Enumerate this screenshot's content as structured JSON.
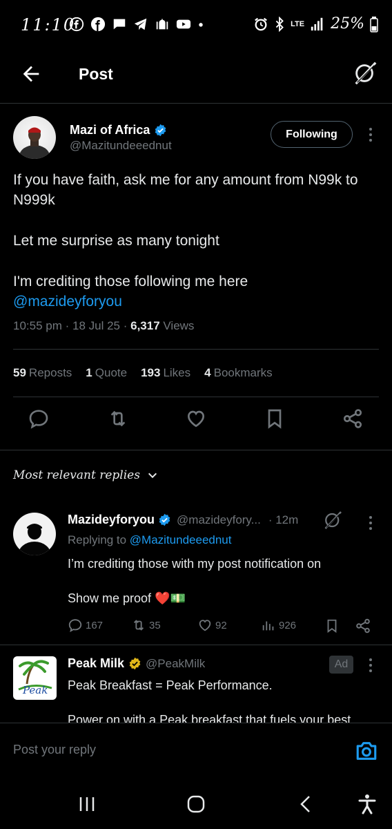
{
  "status_bar": {
    "time": "11:10",
    "network": "LTE",
    "battery": "25%",
    "icons": [
      "facebook-icon",
      "facebook-icon",
      "chat-icon",
      "telegram-icon",
      "mosque-icon",
      "youtube-icon",
      "dot-icon",
      "alarm-icon",
      "bluetooth-icon",
      "signal-icon",
      "battery-icon"
    ]
  },
  "header": {
    "title": "Post",
    "back_icon": "arrow-left-icon",
    "grok_icon": "grok-icon"
  },
  "post": {
    "author_name": "Mazi of Africa",
    "author_handle": "@Mazitundeeednut",
    "follow_label": "Following",
    "text_line1": "If you have faith, ask me for any amount from N99k to N999k",
    "text_line2": "Let me surprise as many tonight",
    "text_line3": "I'm crediting those following me here",
    "mention": "@mazideyforyou",
    "time": "10:55 pm",
    "date": "18 Jul 25",
    "views_count": "6,317",
    "views_label": "Views",
    "reposts_count": "59",
    "reposts_label": "Reposts",
    "quotes_count": "1",
    "quotes_label": "Quote",
    "likes_count": "193",
    "likes_label": "Likes",
    "bookmarks_count": "4",
    "bookmarks_label": "Bookmarks"
  },
  "replies_sort_label": "Most relevant replies",
  "reply": {
    "name": "Mazideyforyou",
    "handle": "@mazideyfory...",
    "time": "· 12m",
    "replying_to_prefix": "Replying to",
    "replying_to_handle": "@Mazitundeeednut",
    "text_line1": "I’m crediting those with my post notification on",
    "text_line2": "Show me proof ❤️💵",
    "replies_count": "167",
    "reposts_count": "35",
    "likes_count": "92",
    "views_count": "926"
  },
  "ad": {
    "name": "Peak Milk",
    "handle": "@PeakMilk",
    "badge": "Ad",
    "logo_text": "Peak",
    "text_line1": "Peak Breakfast = Peak Performance.",
    "text_line2": "Power on with a Peak breakfast that fuels your best."
  },
  "composer": {
    "placeholder": "Post your reply"
  },
  "colors": {
    "background": "#000000",
    "accent": "#1d9bf0",
    "muted": "#71767b",
    "divider": "#2f3336",
    "gold_badge": "#e2b719"
  }
}
